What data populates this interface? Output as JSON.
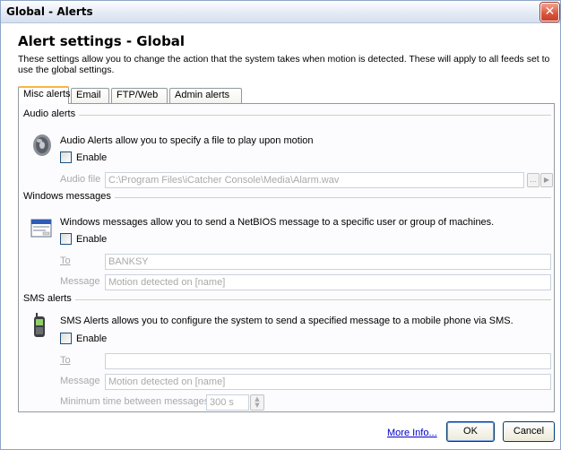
{
  "window": {
    "title": "Global - Alerts",
    "close_glyph": "✕"
  },
  "header": {
    "heading": "Alert settings - Global",
    "description": "These settings allow you to change the action that the system takes when motion is detected. These will apply to all feeds set to use the global settings."
  },
  "tabs": [
    {
      "label": "Misc alerts",
      "active": true
    },
    {
      "label": "Email",
      "active": false
    },
    {
      "label": "FTP/Web",
      "active": false
    },
    {
      "label": "Admin alerts",
      "active": false
    }
  ],
  "audio": {
    "group_label": "Audio alerts",
    "icon": "speaker-icon",
    "description": "Audio Alerts allow you to specify a file to play upon motion",
    "enable_label": "Enable",
    "enabled": false,
    "file_label": "Audio file",
    "file_value": "C:\\Program Files\\iCatcher Console\\Media\\Alarm.wav",
    "browse_glyph": "…",
    "play_glyph": "▶"
  },
  "windows": {
    "group_label": "Windows messages",
    "icon": "network-message-icon",
    "description": "Windows messages allow you to send a NetBIOS message to a specific user or group of machines.",
    "enable_label": "Enable",
    "enabled": false,
    "to_label": "To",
    "to_value": "BANKSY",
    "message_label": "Message",
    "message_value": "Motion detected on [name]"
  },
  "sms": {
    "group_label": "SMS alerts",
    "icon": "mobile-phone-icon",
    "description": "SMS Alerts allows you to configure the system to send a specified message to a mobile phone via SMS.",
    "enable_label": "Enable",
    "enabled": false,
    "to_label": "To",
    "to_value": "",
    "message_label": "Message",
    "message_value": "Motion detected on [name]",
    "min_time_label": "Minimum time between messages",
    "min_time_value": "300 s"
  },
  "footer": {
    "more_info": "More Info...",
    "ok": "OK",
    "cancel": "Cancel"
  },
  "colors": {
    "link": "#0000cc",
    "tab_highlight": "#f8b544",
    "close_button": "#d9553b"
  }
}
